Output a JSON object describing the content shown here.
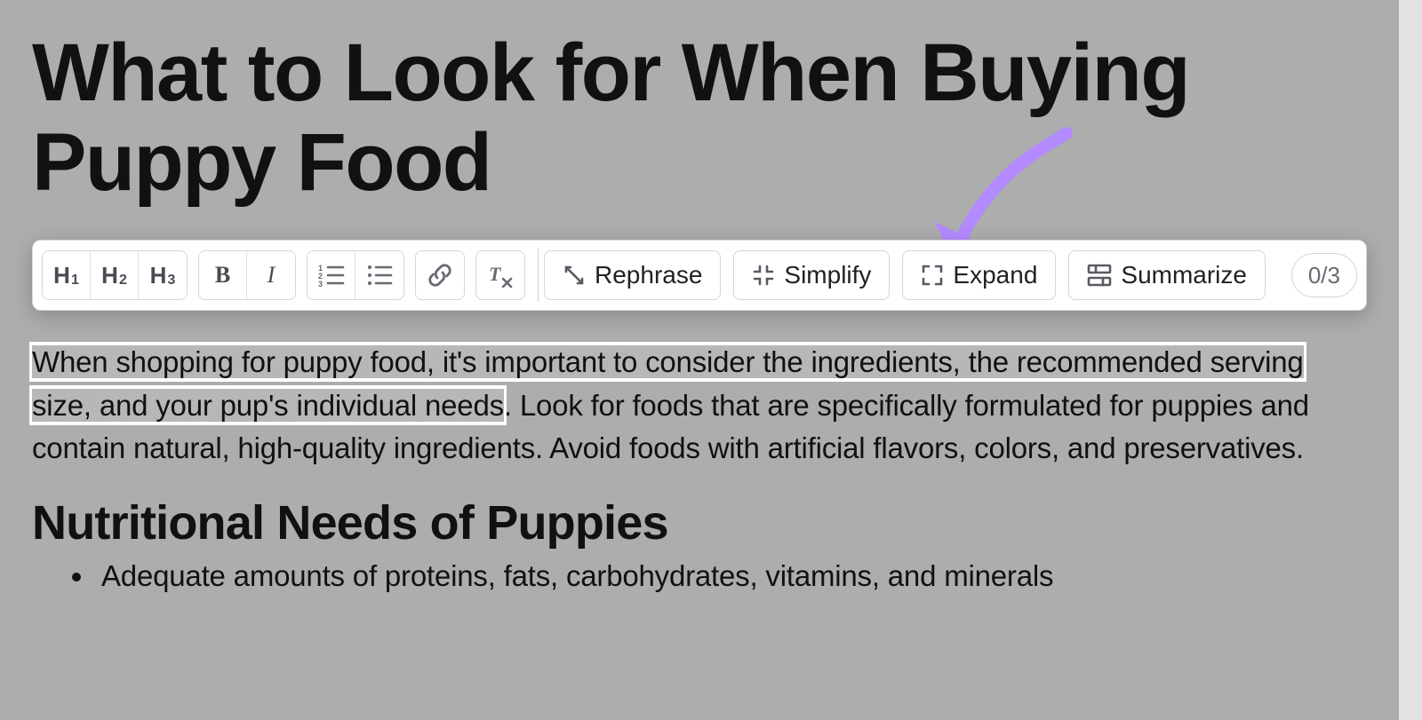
{
  "title": "What to Look for When Buying Puppy Food",
  "toolbar": {
    "headings": {
      "h1": "H",
      "h1sub": "1",
      "h2": "H",
      "h2sub": "2",
      "h3": "H",
      "h3sub": "3"
    },
    "bold": "B",
    "italic": "I",
    "ai": {
      "rephrase": "Rephrase",
      "simplify": "Simplify",
      "expand": "Expand",
      "summarize": "Summarize"
    },
    "counter": "0/3"
  },
  "body": {
    "highlighted": "When shopping for puppy food, it's important to consider the ingredients, the recommended serving size, and your pup's individual needs",
    "rest": ". Look for foods that are specifically formulated for puppies and contain natural, high-quality ingredients. Avoid foods with artificial flavors, colors, and preservatives."
  },
  "subheading": "Nutritional Needs of Puppies",
  "bullets": {
    "0": "Adequate amounts of proteins, fats, carbohydrates, vitamins, and minerals"
  },
  "colors": {
    "arrow": "#b38aff",
    "highlight_bg": "#b7b7b7",
    "page_bg": "#adadad"
  }
}
